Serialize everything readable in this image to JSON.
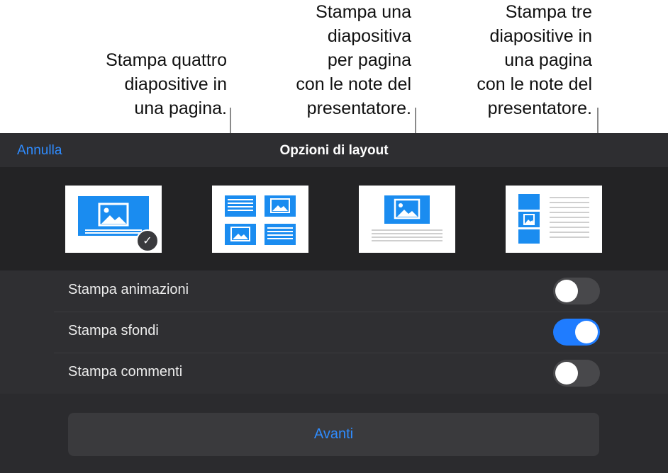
{
  "callouts": [
    {
      "id": "four",
      "text": "Stampa quattro\ndiapositive in\nuna pagina."
    },
    {
      "id": "one",
      "text": "Stampa una\ndiapositiva\nper pagina\ncon le note del\npresentatore."
    },
    {
      "id": "three",
      "text": "Stampa tre\ndiapositive in\nuna pagina\ncon le note del\npresentatore."
    }
  ],
  "header": {
    "cancel_label": "Annulla",
    "title": "Opzioni di layout"
  },
  "layouts": [
    {
      "name": "una diapositiva",
      "selected": true
    },
    {
      "name": "quattro diapositive",
      "selected": false
    },
    {
      "name": "una diapositiva con note",
      "selected": false
    },
    {
      "name": "tre diapositive con note",
      "selected": false
    }
  ],
  "options": [
    {
      "label": "Stampa animazioni",
      "on": false
    },
    {
      "label": "Stampa sfondi",
      "on": true
    },
    {
      "label": "Stampa commenti",
      "on": false
    }
  ],
  "footer": {
    "next_label": "Avanti"
  },
  "colors": {
    "accent": "#2f8cff",
    "toggle_on": "#1f7cff",
    "slide_blue": "#1a8cf0"
  }
}
